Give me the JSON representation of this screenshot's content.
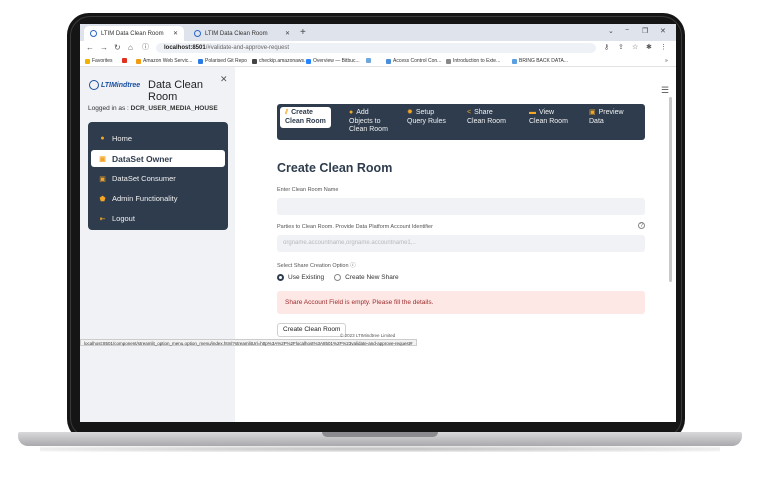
{
  "browser": {
    "tabs": [
      {
        "title": "LTIM Data Clean Room",
        "active": true
      },
      {
        "title": "LTIM Data Clean Room",
        "active": false
      }
    ],
    "url_host": "localhost:8501",
    "url_path": "/#validate-and-approve-request",
    "bookmarks": [
      {
        "label": "Favorites",
        "color": "#f0b400"
      },
      {
        "label": "",
        "color": "#e0321e"
      },
      {
        "label": "Amazon Web Servic...",
        "color": "#f39c12"
      },
      {
        "label": "Polarised Git Repo",
        "color": "#2c7be5"
      },
      {
        "label": "checkip.amazonaws...",
        "color": "#444444"
      },
      {
        "label": "Overview — Bitbuc...",
        "color": "#2684ff"
      },
      {
        "label": "",
        "color": "#6fa8dc"
      },
      {
        "label": "Access Control Con...",
        "color": "#4a90d9"
      },
      {
        "label": "Introduction to Exte...",
        "color": "#888888"
      },
      {
        "label": "BRING BACK DATA...",
        "color": "#5aa0e0"
      }
    ],
    "bookmarks_more": "»"
  },
  "sidebar": {
    "brand": "LTIMindtree",
    "title": "Data Clean Room",
    "logged_in_prefix": "Logged in as : ",
    "logged_in_user": "DCR_USER_MEDIA_HOUSE",
    "menu": [
      {
        "label": "Home",
        "selected": false
      },
      {
        "label": "DataSet Owner",
        "selected": true
      },
      {
        "label": "DataSet Consumer",
        "selected": false
      },
      {
        "label": "Admin Functionality",
        "selected": false
      },
      {
        "label": "Logout",
        "selected": false
      }
    ]
  },
  "topnav": [
    {
      "line1": "Create",
      "line2": "Clean Room",
      "line3": "",
      "active": true
    },
    {
      "line1": "Add",
      "line2": "Objects to",
      "line3": "Clean Room",
      "active": false
    },
    {
      "line1": "Setup",
      "line2": "Query Rules",
      "line3": "",
      "active": false
    },
    {
      "line1": "Share",
      "line2": "Clean Room",
      "line3": "",
      "active": false
    },
    {
      "line1": "View",
      "line2": "Clean Room",
      "line3": "",
      "active": false
    },
    {
      "line1": "Preview",
      "line2": "Data",
      "line3": "",
      "active": false
    }
  ],
  "form": {
    "heading": "Create Clean Room",
    "name_label": "Enter Clean Room Name",
    "name_value": "",
    "parties_label": "Parties to Clean Room. Provide Data Platform Account Identifier",
    "parties_placeholder": "orgname.accountname,orgname.accountname1,..",
    "share_label": "Select Share Creation Option",
    "options": [
      "Use Existing",
      "Create New Share"
    ],
    "selected_option": "Use Existing",
    "alert": "Share Account Field is empty. Please fill the details.",
    "button": "Create Clean Room"
  },
  "footer": "© 2023 LTIMindtree Limited",
  "status_url": "localhost:8501/component/streamlit_option_menu.option_menu/index.html?streamlitUrl=http%3A%2F%2Flocalhost%3A8501%2F%23validate-and-approve-request#",
  "colors": {
    "menu_bg": "#2e3c4d",
    "accent": "#f5a623",
    "alert_bg": "#fde8e6",
    "alert_text": "#9b2c2c"
  }
}
